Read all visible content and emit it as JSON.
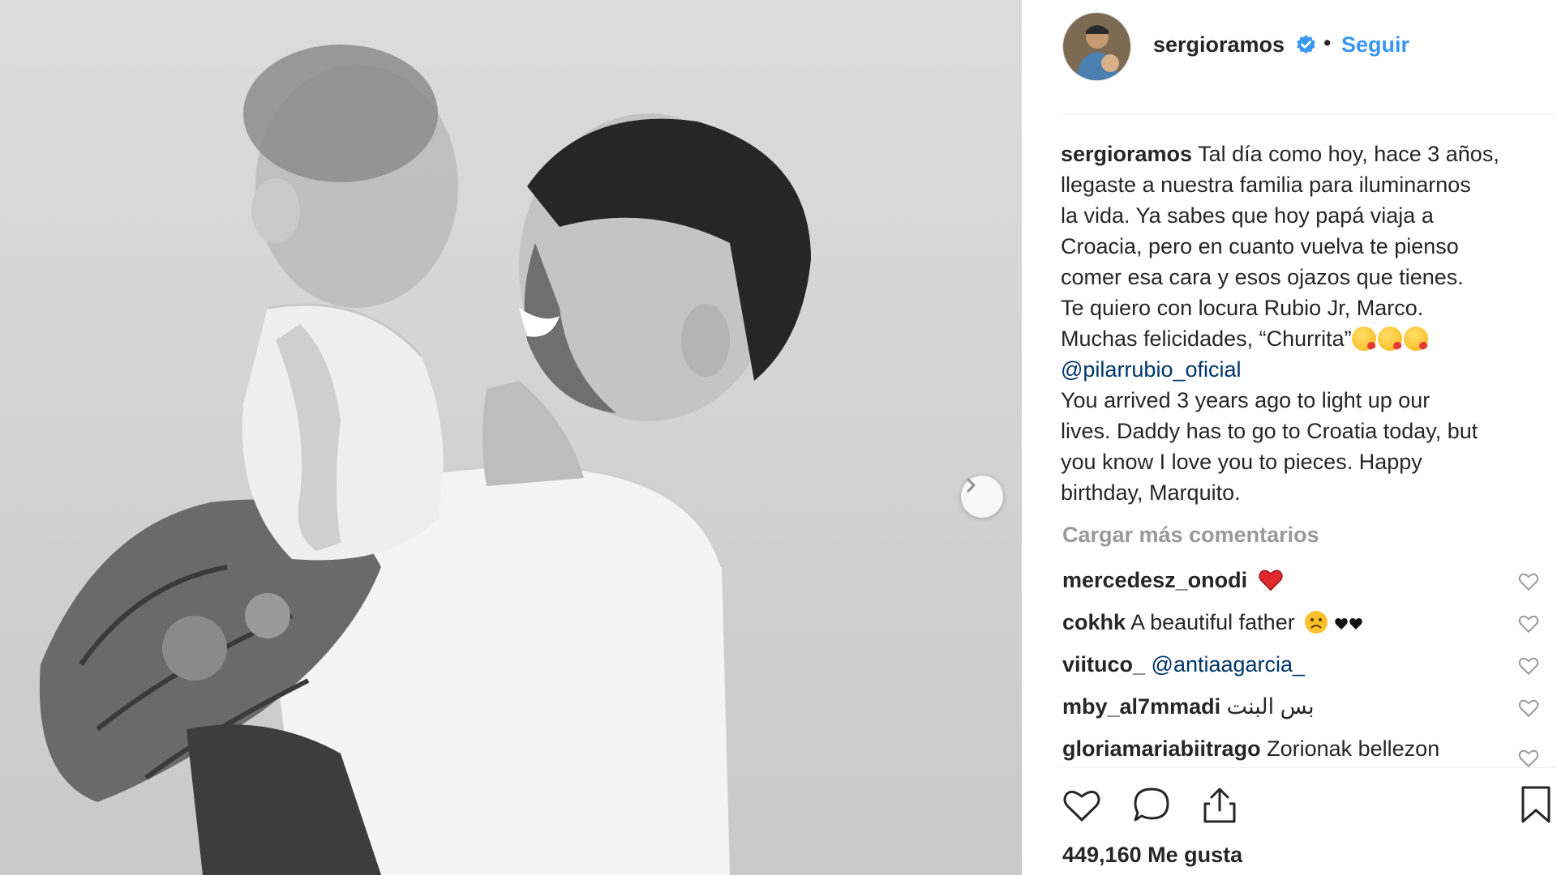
{
  "post": {
    "username": "sergioramos",
    "dot": "•",
    "follow_label": "Seguir",
    "caption_lines": [
      "Tal día como hoy, hace 3 años,",
      "llegaste a nuestra familia para iluminarnos",
      "la vida. Ya sabes que hoy papá viaja a",
      "Croacia, pero en cuanto vuelva te pienso",
      "comer esa cara y esos ojazos que tienes.",
      "Te quiero con locura Rubio Jr, Marco.",
      "Muchas felicidades, “Churrita”"
    ],
    "caption_mention": "@pilarrubio_oficial",
    "caption_english_lines": [
      "You arrived 3 years ago to light up our",
      "lives. Daddy has to go to Croatia today, but",
      "you know I love you to pieces. Happy",
      "birthday, Marquito."
    ],
    "load_more": "Cargar más comentarios",
    "likes_text": "449,160 Me gusta"
  },
  "comments": [
    {
      "user": "mercedesz_onodi",
      "text": "",
      "emoji": "red-heart"
    },
    {
      "user": "cokhk",
      "text": "A beautiful father",
      "emoji": "sad-face-black-hearts"
    },
    {
      "user": "viituco_",
      "mention": "@antiaagarcia_"
    },
    {
      "user": "mby_al7mmadi",
      "text": "بس البنت"
    },
    {
      "user": "gloriamariabiitrago",
      "text": "Zorionak bellezon"
    }
  ],
  "colors": {
    "link_blue": "#3897f0",
    "mention_blue": "#003569",
    "muted_gray": "#999999",
    "text_dark": "#262626"
  },
  "icons": [
    "verified-badge-icon",
    "chevron-right-icon",
    "heart-outline-icon",
    "comment-bubble-icon",
    "share-icon",
    "bookmark-icon"
  ]
}
